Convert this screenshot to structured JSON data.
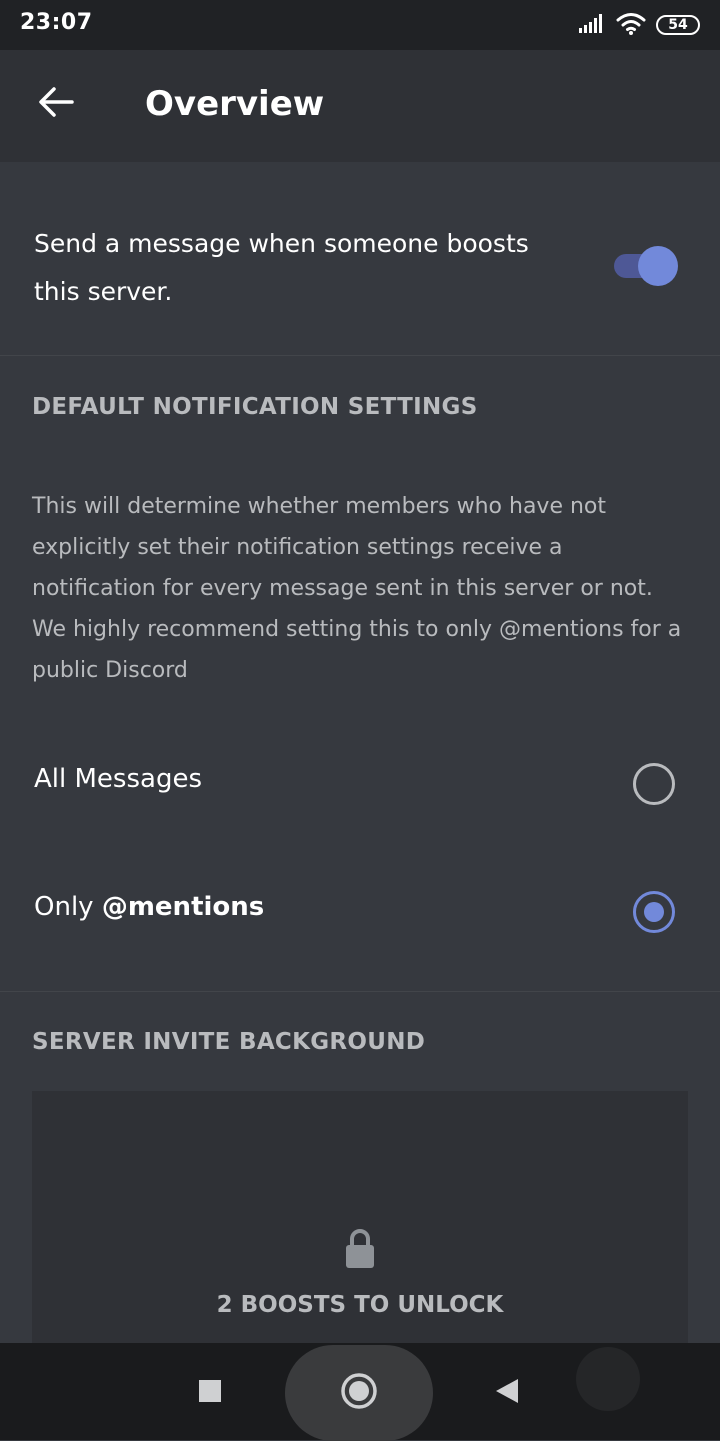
{
  "status_bar": {
    "time": "23:07",
    "battery": "54",
    "icons": [
      "signal-icon",
      "wifi-icon",
      "battery-icon"
    ]
  },
  "app_bar": {
    "back_icon": "arrow-left-icon",
    "title": "Overview"
  },
  "boost_message": {
    "label": "Send a message when someone boosts this server.",
    "enabled": true
  },
  "notifications": {
    "header": "DEFAULT NOTIFICATION SETTINGS",
    "description": "This will determine whether members who have not explicitly set their notification settings receive a notification for every message sent in this server or not. We highly recommend setting this to only @mentions for a public Discord",
    "options": [
      {
        "label_prefix": "All Messages",
        "label_bold": "",
        "selected": false
      },
      {
        "label_prefix": "Only ",
        "label_bold": "@mentions",
        "selected": true
      }
    ]
  },
  "invite_background": {
    "header": "SERVER INVITE BACKGROUND",
    "lock_icon": "lock-icon",
    "unlock_text": "2 BOOSTS TO UNLOCK"
  },
  "nav_bar": {
    "icons": [
      "recents-square-icon",
      "home-circle-icon",
      "back-triangle-icon"
    ]
  },
  "colors": {
    "background": "#36393f",
    "app_bar": "#2f3136",
    "accent": "#7289da",
    "muted_text": "#b9bbbe"
  }
}
